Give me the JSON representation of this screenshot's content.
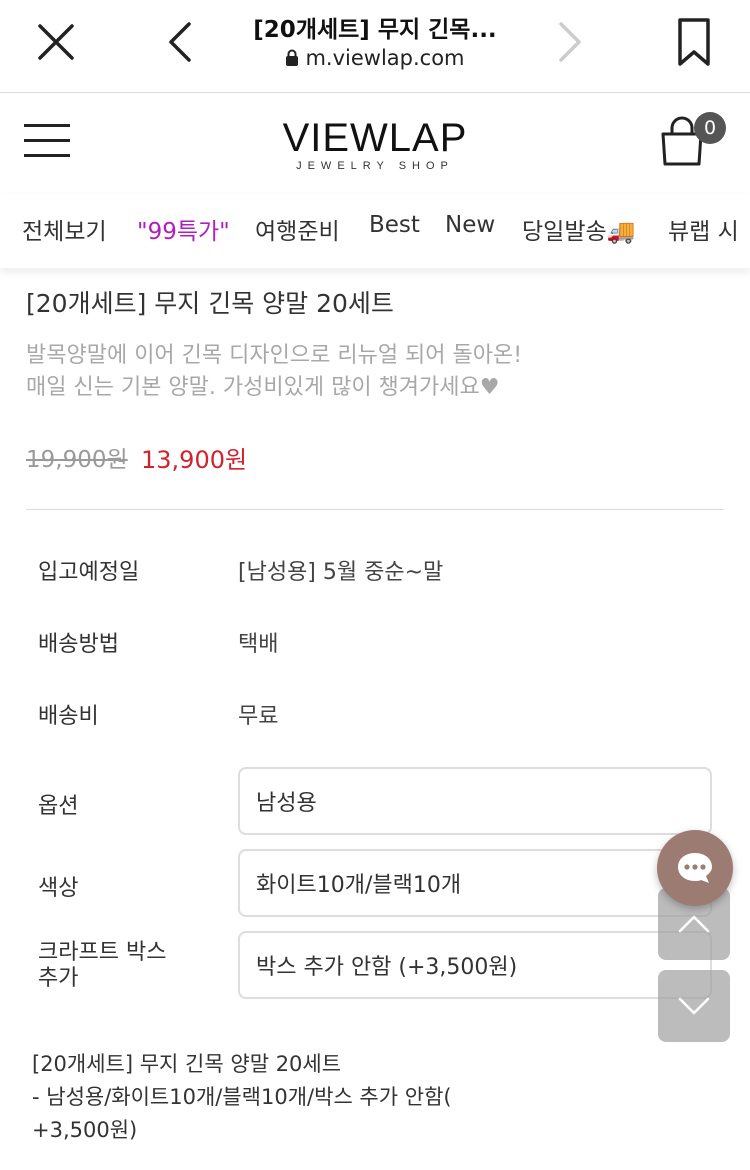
{
  "browser": {
    "page_title": "[20개세트] 무지 긴목...",
    "url": "m.viewlap.com"
  },
  "header": {
    "logo_main": "VIEWLAP",
    "logo_sub": "JEWELRY SHOP",
    "cart_count": "0"
  },
  "categories": [
    {
      "label": "전체보기",
      "color": "#333333"
    },
    {
      "label": "\"99특가\"",
      "color": "#b01ec0"
    },
    {
      "label": "여행준비",
      "color": "#333333"
    },
    {
      "label": "Best",
      "color": "#333333"
    },
    {
      "label": "New",
      "color": "#333333"
    },
    {
      "label": "당일발송🚚",
      "color": "#333333"
    },
    {
      "label": "뷰랩 시",
      "color": "#333333"
    }
  ],
  "product": {
    "title": "[20개세트] 무지 긴목 양말 20세트",
    "desc_line1": "발목양말에 이어 긴목 디자인으로 리뉴얼 되어 돌아온!",
    "desc_line2": "매일 신는 기본 양말. 가성비있게 많이 챙겨가세요♥",
    "price_original": "19,900원",
    "price_sale": "13,900원"
  },
  "info": [
    {
      "label": "입고예정일",
      "value": "[남성용] 5월 중순~말"
    },
    {
      "label": "배송방법",
      "value": "택배"
    },
    {
      "label": "배송비",
      "value": "무료"
    }
  ],
  "options": [
    {
      "label": "옵션",
      "value": "남성용"
    },
    {
      "label": "색상",
      "value": "화이트10개/블랙10개"
    },
    {
      "label_line1": "크라프트 박스",
      "label_line2": "추가",
      "value": "박스 추가 안함 (+3,500원)"
    }
  ],
  "summary": {
    "line1": "[20개세트] 무지 긴목 양말 20세트",
    "line2": "- 남성용/화이트10개/블랙10개/박스 추가 안함(",
    "line3": "+3,500원)"
  },
  "colors": {
    "sale_price": "#d2232a",
    "promo_category": "#b01ec0",
    "chat_button": "#9c7c72"
  },
  "icons": [
    "close-icon",
    "back-icon",
    "forward-icon",
    "bookmark-icon",
    "lock-icon",
    "menu-icon",
    "cart-icon",
    "chat-icon",
    "scroll-up-icon",
    "scroll-down-icon"
  ]
}
